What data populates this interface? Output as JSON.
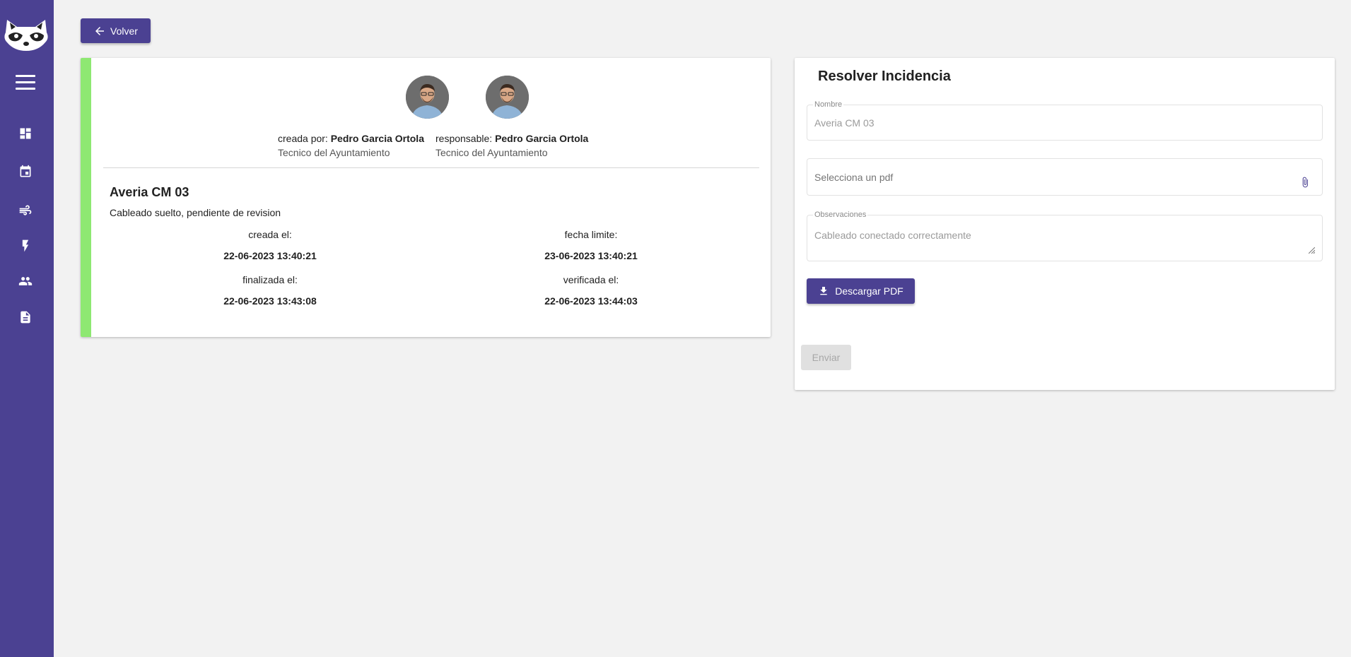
{
  "back_button": {
    "label": "Volver"
  },
  "sidebar": {
    "items": [
      {
        "name": "dashboard-icon"
      },
      {
        "name": "calendar-icon"
      },
      {
        "name": "wind-icon"
      },
      {
        "name": "lightning-icon"
      },
      {
        "name": "users-icon"
      },
      {
        "name": "document-icon"
      }
    ]
  },
  "incident": {
    "created_by_label": "creada por:",
    "created_by_name": "Pedro Garcia Ortola",
    "created_by_role": "Tecnico del Ayuntamiento",
    "responsible_label": "responsable:",
    "responsible_name": "Pedro Garcia Ortola",
    "responsible_role": "Tecnico del Ayuntamiento",
    "title": "Averia CM 03",
    "description": "Cableado suelto, pendiente de revision",
    "created_at_label": "creada el:",
    "created_at": "22-06-2023 13:40:21",
    "deadline_label": "fecha limite:",
    "deadline": "23-06-2023 13:40:21",
    "finished_at_label": "finalizada el:",
    "finished_at": "22-06-2023 13:43:08",
    "verified_at_label": "verificada el:",
    "verified_at": "22-06-2023 13:44:03"
  },
  "resolve_form": {
    "title": "Resolver Incidencia",
    "name_label": "Nombre",
    "name_value": "Averia CM 03",
    "pdf_placeholder": "Selecciona un pdf",
    "observations_label": "Observaciones",
    "observations_value": "Cableado conectado correctamente",
    "download_label": "Descargar PDF",
    "send_label": "Enviar"
  },
  "colors": {
    "primary": "#4b4192",
    "accent_status": "#8ee872",
    "background": "#f2f2f2"
  }
}
